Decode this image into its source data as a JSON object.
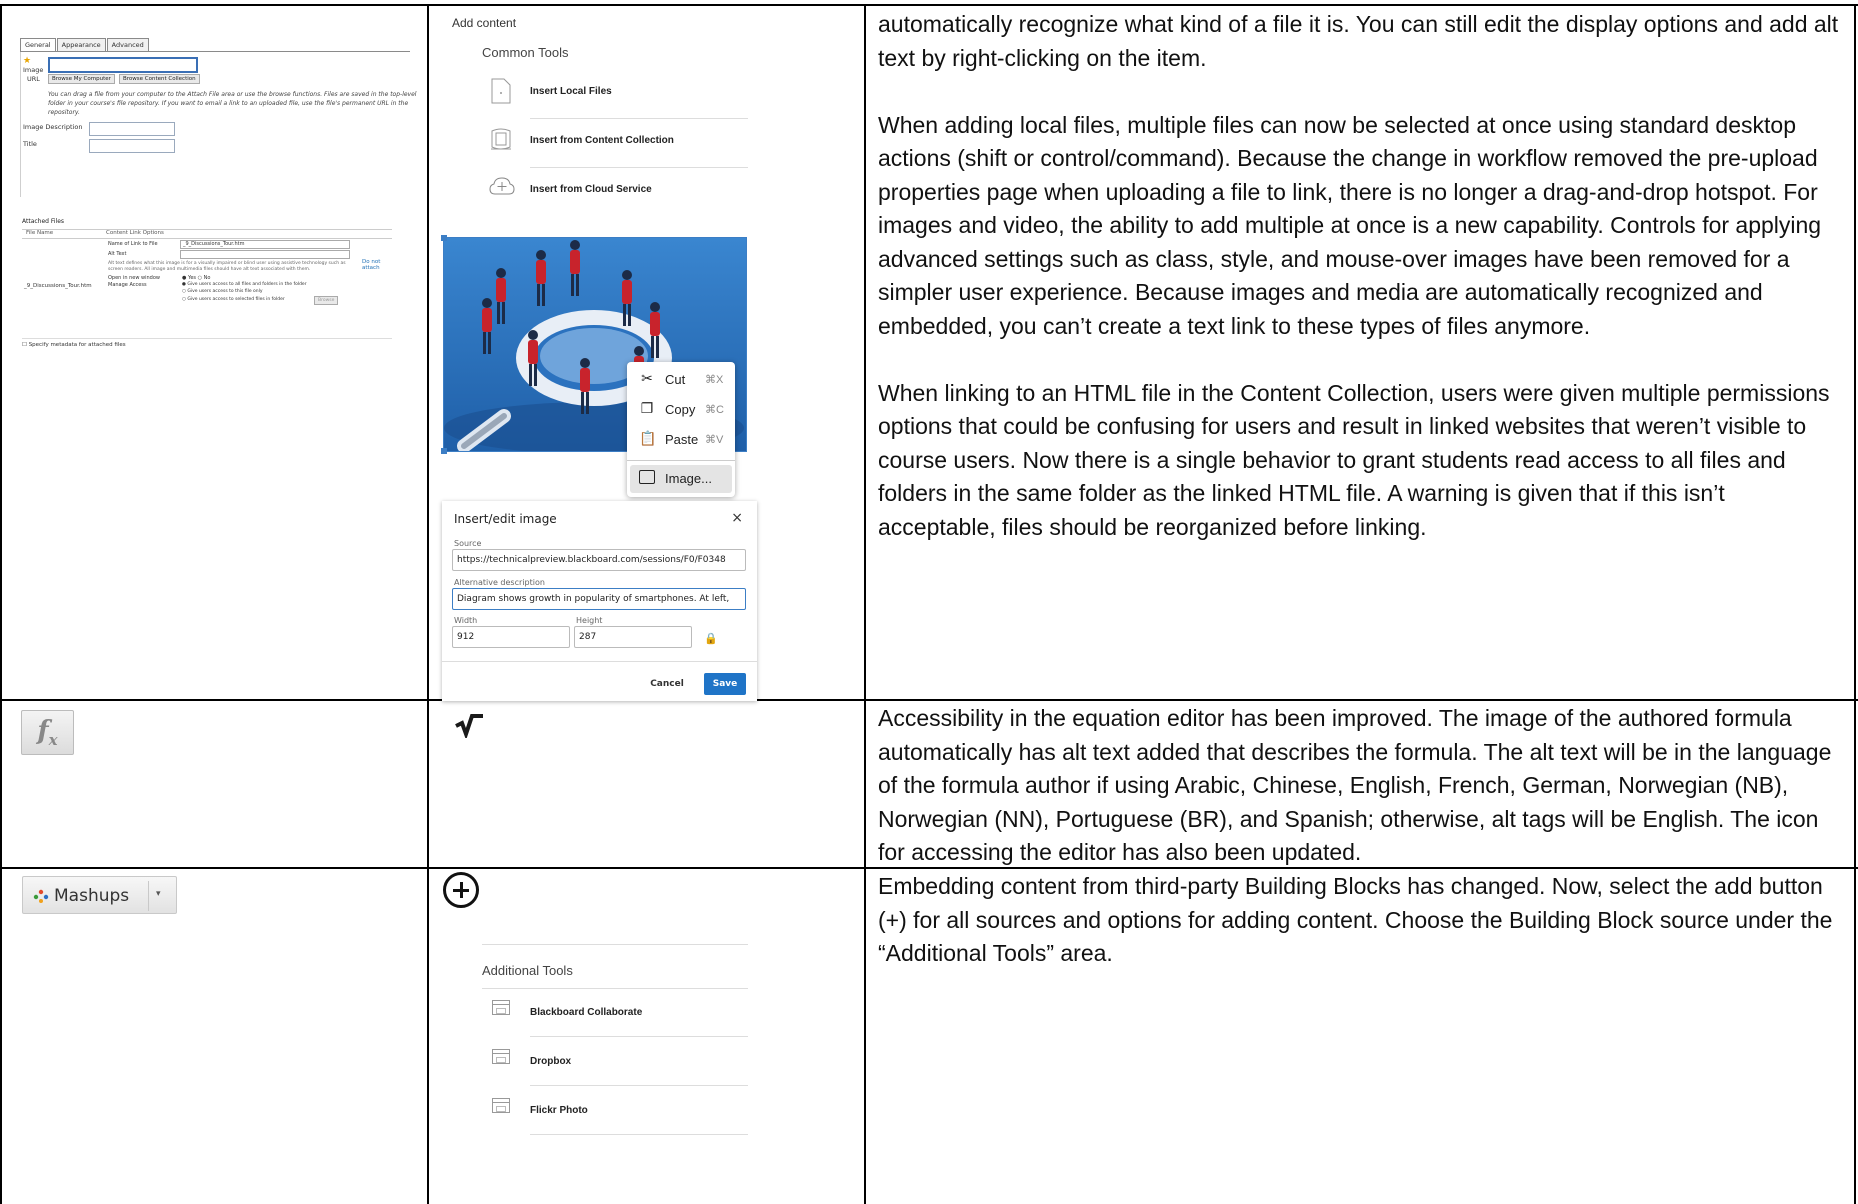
{
  "row1": {
    "classic": {
      "tabs": [
        "General",
        "Appearance",
        "Advanced"
      ],
      "required_mark": "★",
      "image_label": "Image",
      "url_label": "URL",
      "browse_computer": "Browse My Computer",
      "browse_collection": "Browse Content Collection",
      "note": "You can drag a file from your computer to the Attach File area or use the browse functions. Files are saved in the top-level folder in your course's file repository. If you want to email a link to an uploaded file, use the file's permanent URL in the repository.",
      "image_description_label": "Image Description",
      "title_label": "Title",
      "attached": {
        "title": "Attached Files",
        "col_file": "File Name",
        "col_options": "Content Link Options",
        "file_name": "_9_Discussions_Tour.htm",
        "name_of_link_label": "Name of Link to File",
        "name_of_link_value": "_9_Discussions_Tour.htm",
        "alt_text_label": "Alt Text",
        "alt_help": "Alt text defines what this image is for a visually impaired or blind user using assistive technology such as screen readers. All image and multimedia files should have alt text associated with them.",
        "open_new_window_label": "Open in new window",
        "yes": "Yes",
        "no": "No",
        "manage_access_label": "Manage Access",
        "access_opt1": "Give users access to all files and folders in the folder",
        "access_opt2": "Give users access to this file only",
        "access_opt3": "Give users access to selected files in folder",
        "browse": "Browse",
        "do_not_attach": "Do not attach",
        "specify_metadata": "Specify metadata for attached files"
      }
    },
    "add_content": {
      "title": "Add content",
      "section": "Common Tools",
      "items": [
        {
          "label": "Insert Local Files",
          "icon": "file-icon"
        },
        {
          "label": "Insert from Content Collection",
          "icon": "content-collection-icon"
        },
        {
          "label": "Insert from Cloud Service",
          "icon": "cloud-add-icon"
        }
      ]
    },
    "context_menu": {
      "items": [
        {
          "label": "Cut",
          "shortcut": "⌘X",
          "icon": "scissors-icon"
        },
        {
          "label": "Copy",
          "shortcut": "⌘C",
          "icon": "copy-icon"
        },
        {
          "label": "Paste",
          "shortcut": "⌘V",
          "icon": "clipboard-icon"
        }
      ],
      "image_item": "Image..."
    },
    "dialog": {
      "title": "Insert/edit image",
      "close": "×",
      "source_label": "Source",
      "source_value": "https://technicalpreview.blackboard.com/sessions/F0/F0348",
      "alt_label": "Alternative description",
      "alt_value": "Diagram shows growth in popularity of smartphones. At left,",
      "width_label": "Width",
      "width_value": "912",
      "height_label": "Height",
      "height_value": "287",
      "cancel": "Cancel",
      "save": "Save"
    },
    "description_p1": "automatically recognize what kind of a file it is. You can still edit the display options and add alt text by right-clicking on the item.",
    "description_p2": "When adding local files, multiple files can now be selected at once using standard desktop actions (shift or control/command). Because the change in workflow removed the pre-upload properties page when uploading a file to link, there is no longer a drag-and-drop hotspot. For images and video, the ability to add multiple at once is a new capability. Controls for applying advanced settings such as class, style, and mouse-over images have been removed for a simpler user experience. Because images and media are automatically recognized and embedded, you can’t create a text link to these types of files anymore.",
    "description_p3": "When linking to an HTML file in the Content Collection, users were given multiple permissions options that could be confusing for users and result in linked websites that weren’t visible to course users. Now there is a single behavior to grant students read access to all files and folders in the same folder as the linked HTML file. A warning is given that if this isn’t acceptable, files should be reorganized before linking."
  },
  "row2": {
    "old_icon_text": "f",
    "old_icon_sub": "x",
    "new_icon_text": "√‾",
    "description": "Accessibility in the equation editor has been improved. The image of the authored formula automatically has alt text added that describes the formula. The alt text will be in the language of the formula author if using Arabic, Chinese, English, French, German, Norwegian (NB), Norwegian (NN), Portuguese (BR), and Spanish; otherwise, alt tags will be English. The icon for accessing the editor has also been updated."
  },
  "row3": {
    "mashups_label": "Mashups",
    "mashups_arrow": "▾",
    "section": "Additional Tools",
    "items": [
      "Blackboard Collaborate",
      "Dropbox",
      "Flickr Photo"
    ],
    "description": "Embedding content from third-party Building Blocks has changed. Now, select the add button (+) for all sources and options for adding content. Choose the Building Block source under the “Additional Tools” area."
  },
  "colors": {
    "border": "#000000",
    "accent_blue": "#1f74c7",
    "illustration_bg": "#2f74c0",
    "figure_red": "#c8232c"
  }
}
